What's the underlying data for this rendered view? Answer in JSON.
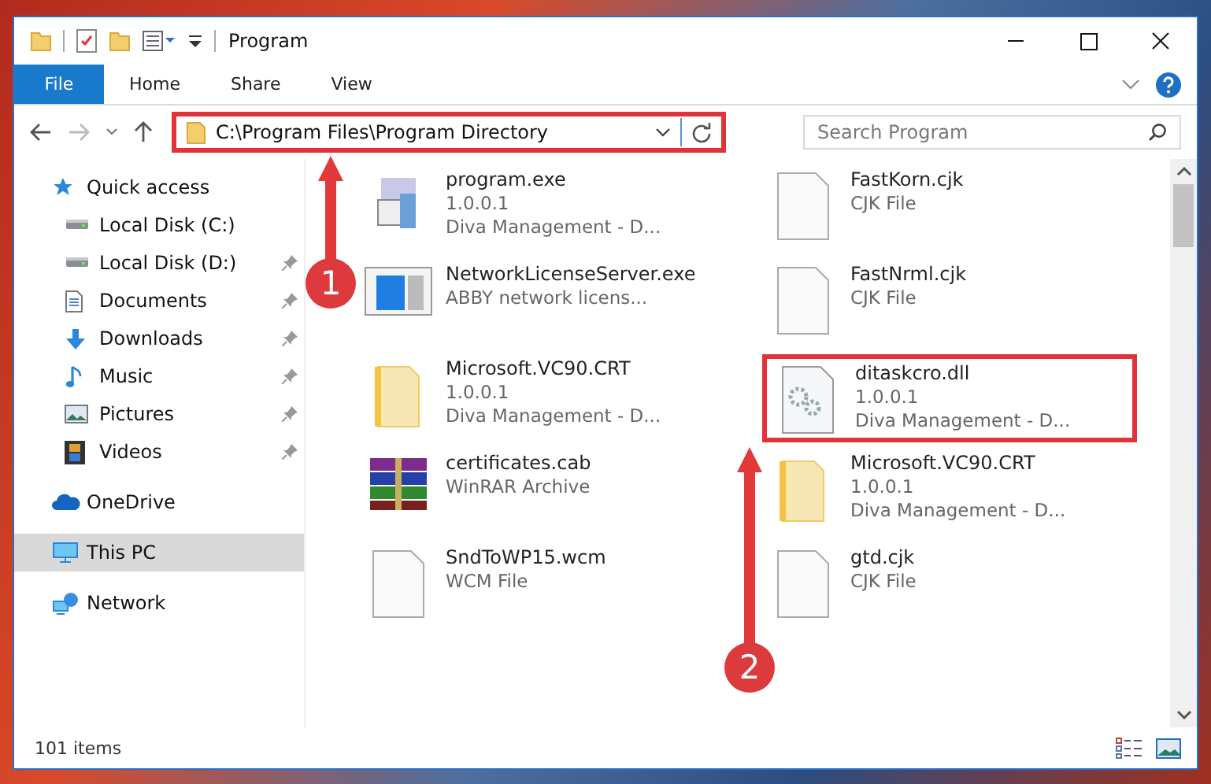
{
  "window": {
    "title": "Program"
  },
  "ribbon_tabs": [
    {
      "label": "File",
      "selected": true
    },
    {
      "label": "Home",
      "selected": false
    },
    {
      "label": "Share",
      "selected": false
    },
    {
      "label": "View",
      "selected": false
    }
  ],
  "address_bar": {
    "path": "C:\\Program Files\\Program Directory",
    "highlighted": true
  },
  "search": {
    "placeholder": "Search Program"
  },
  "sidebar": {
    "items": [
      {
        "label": "Quick access",
        "kind": "star",
        "selected": false,
        "pinned": false,
        "children": [
          {
            "label": "Local Disk (C:)",
            "kind": "drive",
            "selected": false,
            "pinned": false
          },
          {
            "label": "Local Disk (D:)",
            "kind": "drive",
            "selected": false,
            "pinned": true
          },
          {
            "label": "Documents",
            "kind": "document",
            "selected": false,
            "pinned": true
          },
          {
            "label": "Downloads",
            "kind": "download",
            "selected": false,
            "pinned": true
          },
          {
            "label": "Music",
            "kind": "music",
            "selected": false,
            "pinned": true
          },
          {
            "label": "Pictures",
            "kind": "picture",
            "selected": false,
            "pinned": true
          },
          {
            "label": "Videos",
            "kind": "video",
            "selected": false,
            "pinned": true
          }
        ]
      },
      {
        "label": "OneDrive",
        "kind": "cloud",
        "selected": false,
        "pinned": false
      },
      {
        "label": "This PC",
        "kind": "monitor",
        "selected": true,
        "pinned": false
      },
      {
        "label": "Network",
        "kind": "network",
        "selected": false,
        "pinned": false
      }
    ]
  },
  "files": [
    {
      "name": "program.exe",
      "details": [
        "1.0.0.1",
        "Diva Management - D..."
      ],
      "kind": "app",
      "highlighted": false
    },
    {
      "name": "FastKorn.cjk",
      "details": [
        "CJK File"
      ],
      "kind": "blank",
      "highlighted": false
    },
    {
      "name": "NetworkLicenseServer.exe",
      "details": [
        "ABBY network licens..."
      ],
      "kind": "window",
      "highlighted": false
    },
    {
      "name": "FastNrml.cjk",
      "details": [
        "CJK File"
      ],
      "kind": "blank",
      "highlighted": false
    },
    {
      "name": "Microsoft.VC90.CRT",
      "details": [
        "1.0.0.1",
        "Diva Management - D..."
      ],
      "kind": "folder",
      "highlighted": false
    },
    {
      "name": "ditaskcro.dll",
      "details": [
        "1.0.0.1",
        "Diva Management - D..."
      ],
      "kind": "gears",
      "highlighted": true
    },
    {
      "name": "certificates.cab",
      "details": [
        "WinRAR Archive"
      ],
      "kind": "archive",
      "highlighted": false
    },
    {
      "name": "Microsoft.VC90.CRT",
      "details": [
        "1.0.0.1",
        "Diva Management - D..."
      ],
      "kind": "folder",
      "highlighted": false
    },
    {
      "name": "SndToWP15.wcm",
      "details": [
        "WCM File"
      ],
      "kind": "blank",
      "highlighted": false
    },
    {
      "name": "gtd.cjk",
      "details": [
        "CJK File"
      ],
      "kind": "blank",
      "highlighted": false
    }
  ],
  "status_bar": {
    "item_count": "101 items"
  },
  "annotations": [
    {
      "label": "1"
    },
    {
      "label": "2"
    }
  ]
}
